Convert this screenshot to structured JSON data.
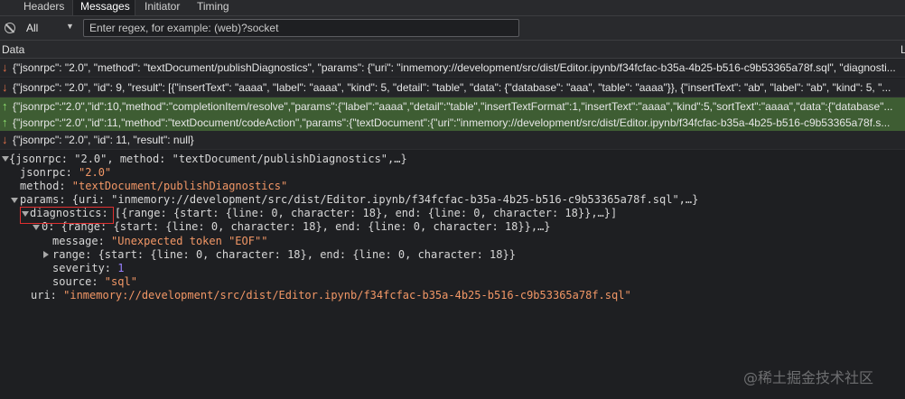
{
  "tabs": [
    "Headers",
    "Messages",
    "Initiator",
    "Timing"
  ],
  "active_tab": "Messages",
  "filter": {
    "selected": "All",
    "placeholder": "Enter regex, for example: (web)?socket",
    "value": ""
  },
  "columns": {
    "data": "Data",
    "right": "L"
  },
  "messages": [
    {
      "dir": "received",
      "text": "{\"jsonrpc\": \"2.0\", \"method\": \"textDocument/publishDiagnostics\", \"params\": {\"uri\": \"inmemory://development/src/dist/Editor.ipynb/f34fcfac-b35a-4b25-b516-c9b53365a78f.sql\", \"diagnosti..."
    },
    {
      "dir": "received",
      "text": "{\"jsonrpc\": \"2.0\", \"id\": 9, \"result\": [{\"insertText\": \"aaaa\", \"label\": \"aaaa\", \"kind\": 5, \"detail\": \"table\", \"data\": {\"database\": \"aaa\", \"table\": \"aaaa\"}}, {\"insertText\": \"ab\", \"label\": \"ab\", \"kind\": 5, \"..."
    },
    {
      "dir": "sent",
      "text": "{\"jsonrpc\":\"2.0\",\"id\":10,\"method\":\"completionItem/resolve\",\"params\":{\"label\":\"aaaa\",\"detail\":\"table\",\"insertTextFormat\":1,\"insertText\":\"aaaa\",\"kind\":5,\"sortText\":\"aaaa\",\"data\":{\"database\"..."
    },
    {
      "dir": "sent",
      "text": "{\"jsonrpc\":\"2.0\",\"id\":11,\"method\":\"textDocument/codeAction\",\"params\":{\"textDocument\":{\"uri\":\"inmemory://development/src/dist/Editor.ipynb/f34fcfac-b35a-4b25-b516-c9b53365a78f.s..."
    },
    {
      "dir": "received",
      "text": "{\"jsonrpc\": \"2.0\", \"id\": 11, \"result\": null}"
    }
  ],
  "tree": {
    "root": "{jsonrpc: \"2.0\", method: \"textDocument/publishDiagnostics\",…}",
    "jsonrpc_key": "jsonrpc: ",
    "jsonrpc_val": "\"2.0\"",
    "method_key": "method: ",
    "method_val": "\"textDocument/publishDiagnostics\"",
    "params": "params: {uri: \"inmemory://development/src/dist/Editor.ipynb/f34fcfac-b35a-4b25-b516-c9b53365a78f.sql\",…}",
    "diag_key": "diagnostics:",
    "diag_val": " [{range: {start: {line: 0, character: 18}, end: {line: 0, character: 18}},…}]",
    "item0": "0: {range: {start: {line: 0, character: 18}, end: {line: 0, character: 18}},…}",
    "message_key": "message: ",
    "message_val": "\"Unexpected token \"EOF\"\"",
    "range": "range: {start: {line: 0, character: 18}, end: {line: 0, character: 18}}",
    "severity_key": "severity: ",
    "severity_val": "1",
    "source_key": "source: ",
    "source_val": "\"sql\"",
    "uri_key": "uri: ",
    "uri_val": "\"inmemory://development/src/dist/Editor.ipynb/f34fcfac-b35a-4b25-b516-c9b53365a78f.sql\""
  },
  "watermark": "@稀土掘金技术社区"
}
